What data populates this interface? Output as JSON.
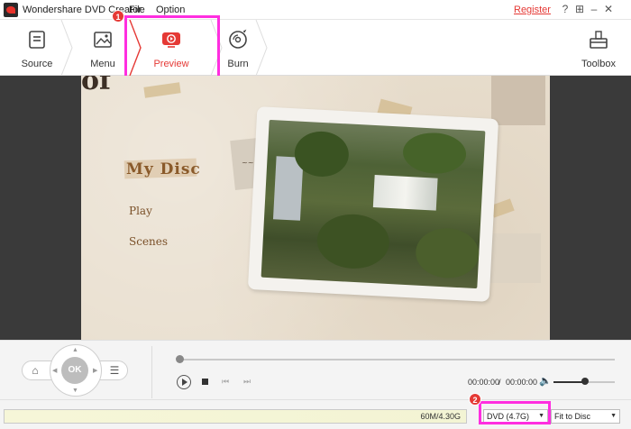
{
  "window": {
    "title": "Wondershare DVD Creator",
    "menus": [
      "File",
      "Option"
    ],
    "register": "Register"
  },
  "toolbar": {
    "source": "Source",
    "menu": "Menu",
    "preview": "Preview",
    "burn": "Burn",
    "toolbox": "Toolbox"
  },
  "callouts": {
    "one": "1",
    "two": "2"
  },
  "disc_menu": {
    "title": "My Disc",
    "play": "Play",
    "scenes": "Scenes",
    "big_letters": "of"
  },
  "player": {
    "ok": "OK",
    "current_time": "00:00:00",
    "separator": "/",
    "total_time": "00:00:00",
    "playback_progress": 0,
    "volume_level": 0.5
  },
  "status": {
    "capacity_text": "60M/4.30G",
    "disc_type": "DVD (4.7G)",
    "fit_mode": "Fit to Disc"
  },
  "colors": {
    "accent": "#e53935",
    "highlight": "#ff2ee0"
  }
}
